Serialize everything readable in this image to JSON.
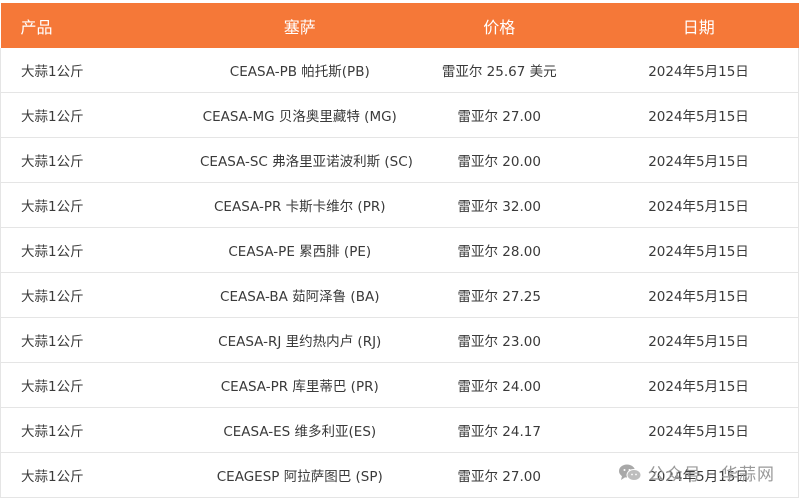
{
  "table": {
    "headers": [
      "产品",
      "塞萨",
      "价格",
      "日期"
    ],
    "rows": [
      [
        "大蒜1公斤",
        "CEASA-PB 帕托斯(PB)",
        "雷亚尔 25.67 美元",
        "2024年5月15日"
      ],
      [
        "大蒜1公斤",
        "CEASA-MG 贝洛奥里藏特 (MG)",
        "雷亚尔 27.00",
        "2024年5月15日"
      ],
      [
        "大蒜1公斤",
        "CEASA-SC 弗洛里亚诺波利斯 (SC)",
        "雷亚尔 20.00",
        "2024年5月15日"
      ],
      [
        "大蒜1公斤",
        "CEASA-PR 卡斯卡维尔 (PR)",
        "雷亚尔 32.00",
        "2024年5月15日"
      ],
      [
        "大蒜1公斤",
        "CEASA-PE 累西腓 (PE)",
        "雷亚尔 28.00",
        "2024年5月15日"
      ],
      [
        "大蒜1公斤",
        "CEASA-BA 茹阿泽鲁 (BA)",
        "雷亚尔 27.25",
        "2024年5月15日"
      ],
      [
        "大蒜1公斤",
        "CEASA-RJ 里约热内卢 (RJ)",
        "雷亚尔 23.00",
        "2024年5月15日"
      ],
      [
        "大蒜1公斤",
        "CEASA-PR 库里蒂巴 (PR)",
        "雷亚尔 24.00",
        "2024年5月15日"
      ],
      [
        "大蒜1公斤",
        "CEASA-ES 维多利亚(ES)",
        "雷亚尔 24.17",
        "2024年5月15日"
      ],
      [
        "大蒜1公斤",
        "CEAGESP 阿拉萨图巴 (SP)",
        "雷亚尔 27.00",
        "2024年5月15日"
      ]
    ]
  },
  "watermark": {
    "text": "公众号 · 华蒜网",
    "icon": "wechat-icon"
  },
  "colors": {
    "header_bg": "#f57838",
    "header_text": "#ffffff",
    "row_border": "#e5e5e5",
    "watermark": "#9a9a9a"
  }
}
